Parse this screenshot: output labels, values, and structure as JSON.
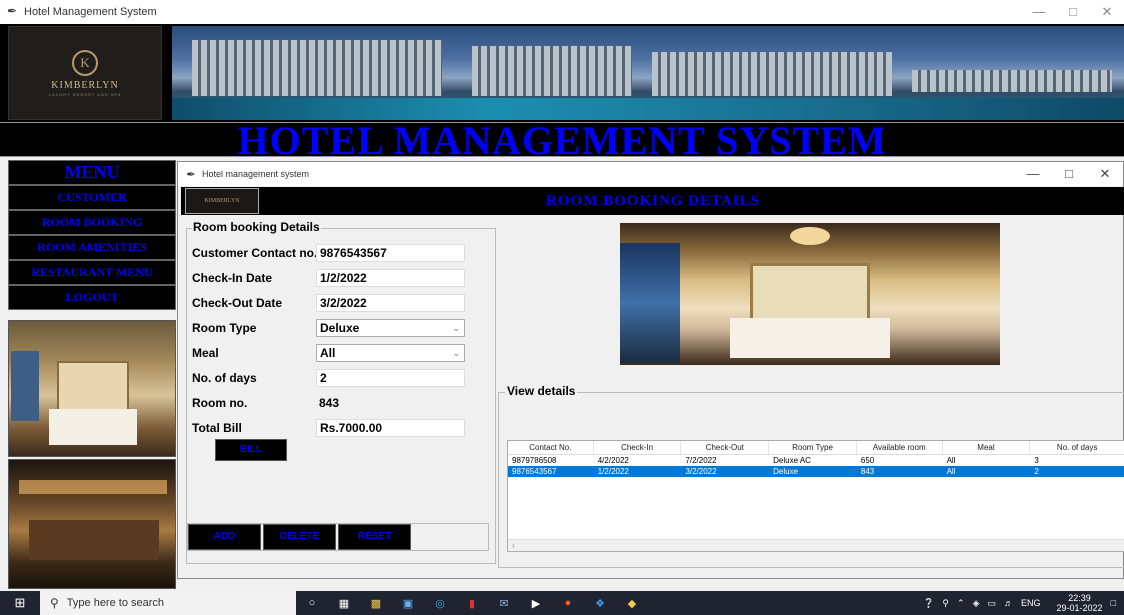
{
  "main_window": {
    "title": "Hotel Management System",
    "controls": [
      "—",
      "□",
      "✕"
    ]
  },
  "logo": {
    "initial": "K",
    "name": "KIMBERLYN",
    "tagline": "LUXURY RESORT AND SPA"
  },
  "banner_title": "HOTEL MANAGEMENT SYSTEM",
  "menu": {
    "title": "MENU",
    "items": [
      "CUSTOMER",
      "ROOM BOOKING",
      "ROOM AMENITIES",
      "RESTAURANT MENU",
      "LOGOUT"
    ]
  },
  "child_window": {
    "title": "Hotel management system",
    "controls": [
      "—",
      "□",
      "✕"
    ],
    "mini_logo": "KIMBERLYN",
    "heading": "ROOM BOOKING DETAILS"
  },
  "form": {
    "legend": "Room booking Details",
    "fields": [
      {
        "label": "Customer Contact no.",
        "value": "9876543567"
      },
      {
        "label": "Check-In Date",
        "value": "1/2/2022"
      },
      {
        "label": "Check-Out Date",
        "value": "3/2/2022"
      },
      {
        "label": "Room Type",
        "value": "Deluxe"
      },
      {
        "label": "Meal",
        "value": "All"
      },
      {
        "label": "No. of days",
        "value": "2"
      },
      {
        "label": "Room no.",
        "value": "843"
      },
      {
        "label": "Total Bill",
        "value": "Rs.7000.00"
      }
    ],
    "bill_button": "BILL",
    "add_button": "ADD",
    "delete_button": "DELETE",
    "reset_button": "RESET"
  },
  "view_details": {
    "legend": "View details",
    "columns": [
      "Contact No.",
      "Check-In",
      "Check-Out",
      "Room Type",
      "Available room",
      "Meal",
      "No. of days"
    ],
    "rows": [
      [
        "9879786508",
        "4/2/2022",
        "7/2/2022",
        "Deluxe AC",
        "650",
        "All",
        "3"
      ],
      [
        "9876543567",
        "1/2/2022",
        "3/2/2022",
        "Deluxe",
        "843",
        "All",
        "2"
      ]
    ],
    "selected_row": 1
  },
  "taskbar": {
    "search_placeholder": "Type here to search",
    "language": "ENG",
    "time": "22:39",
    "date": "29-01-2022"
  }
}
